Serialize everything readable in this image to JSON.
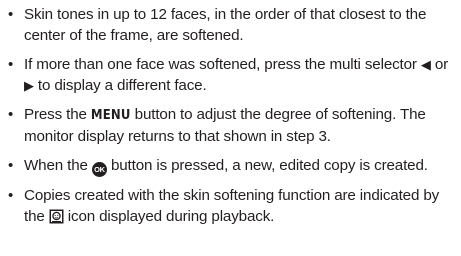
{
  "items": [
    {
      "text": "Skin tones in up to 12 faces, in the order of that closest to the center of the frame, are softened."
    },
    {
      "before": "If more than one face was softened, press the multi selector ",
      "left_glyph": "◀",
      "mid": " or ",
      "right_glyph": "▶",
      "after": " to display a different face."
    },
    {
      "before": "Press the ",
      "key": "MENU",
      "after": " button to adjust the degree of softening. The monitor display returns to that shown in step 3."
    },
    {
      "before": "When the ",
      "icon_label": "OK",
      "after": " button is pressed, a new, edited copy is created."
    },
    {
      "before": "Copies created with the skin softening function are indicated by the ",
      "icon": "skin-softening-icon",
      "after": " icon displayed during playback."
    }
  ],
  "bullet": "•"
}
